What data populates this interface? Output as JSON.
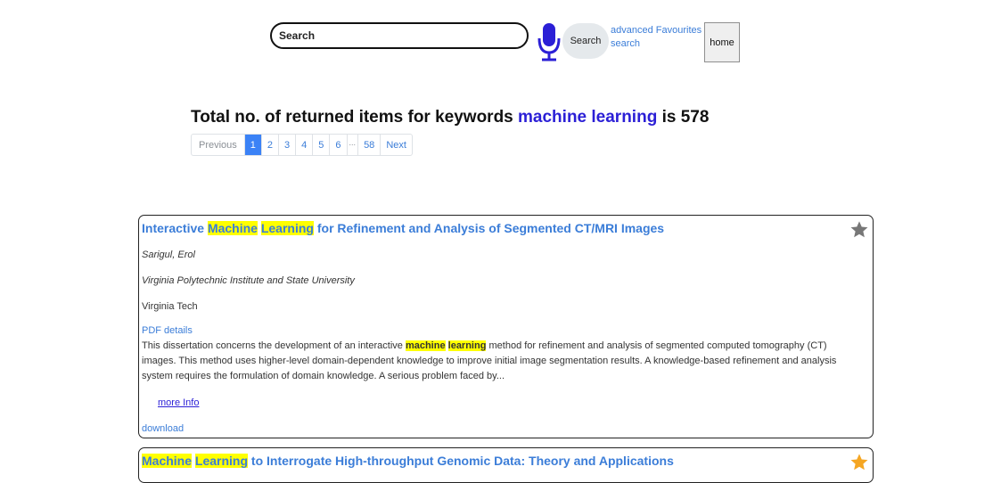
{
  "search": {
    "placeholder": "Search",
    "button_label": "Search",
    "advanced_label": "advanced Favourites search",
    "home_label": "home"
  },
  "results": {
    "prefix": "Total no. of returned items for keywords ",
    "keywords": "machine learning",
    "middle": " is ",
    "count": "578"
  },
  "pagination": {
    "previous": "Previous",
    "pages": [
      "1",
      "2",
      "3",
      "4",
      "5",
      "6"
    ],
    "ellipsis": "...",
    "last": "58",
    "next": "Next",
    "active": "1"
  },
  "items": [
    {
      "title_hl1": "Machine",
      "title_hl2": "Learning",
      "title_before": "Interactive ",
      "title_after": " for Refinement and Analysis of Segmented CT/MRI Images",
      "author": "Sarigul, Erol",
      "institution": "Virginia Polytechnic Institute and State University",
      "publisher": "Virginia Tech",
      "pdf_label": "PDF details",
      "abstract_before": "This dissertation concerns the development of an interactive ",
      "abstract_hl1": "machine",
      "abstract_hl2": "learning",
      "abstract_after": " method for refinement and analysis of segmented computed tomography (CT) images. This method uses higher-level domain-dependent knowledge to improve initial image segmentation results. A knowledge-based refinement and analysis system requires the formulation of domain knowledge. A serious problem faced by...",
      "more_info": "more Info",
      "download": "download",
      "favourite_color": "#777777"
    },
    {
      "title_hl1": "Machine",
      "title_hl2": "Learning",
      "title_after": " to Interrogate High-throughput Genomic Data: Theory and Applications",
      "favourite_color": "#f5a623"
    }
  ],
  "colors": {
    "accent": "#3b82f6",
    "link": "#3b7dd8",
    "keyword": "#2b1fd6",
    "highlight": "#ffff00",
    "mic": "#2b1fd6"
  }
}
